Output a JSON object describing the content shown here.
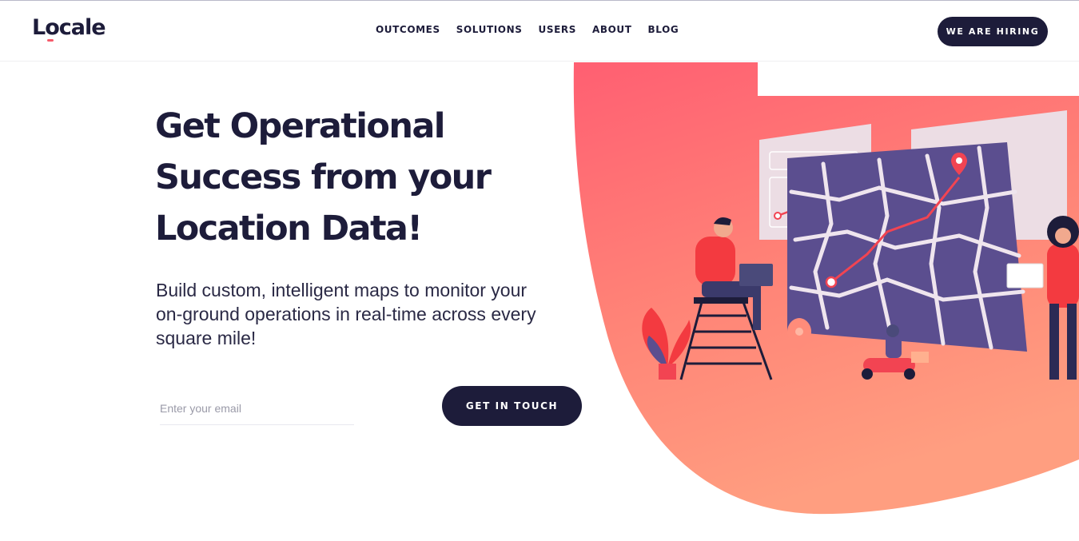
{
  "header": {
    "logo": "Locale",
    "nav": [
      "OUTCOMES",
      "SOLUTIONS",
      "USERS",
      "ABOUT",
      "BLOG"
    ],
    "hiring_label": "WE ARE HIRING"
  },
  "hero": {
    "title_lines": [
      "Get Operational",
      "Success from your",
      "Location Data!"
    ],
    "subtitle_lines": [
      "Build custom, intelligent maps to monitor your",
      "on-ground operations in real-time across every",
      "square mile!"
    ],
    "email_placeholder": "Enter your email",
    "cta_label": "GET IN TOUCH"
  },
  "colors": {
    "brand_dark": "#1d1c3a",
    "accent_coral": "#f9606d",
    "blob_peach": "#ff9a7e",
    "map_purple": "#5b4e8f"
  },
  "icons": [
    "location-pin-icon"
  ]
}
